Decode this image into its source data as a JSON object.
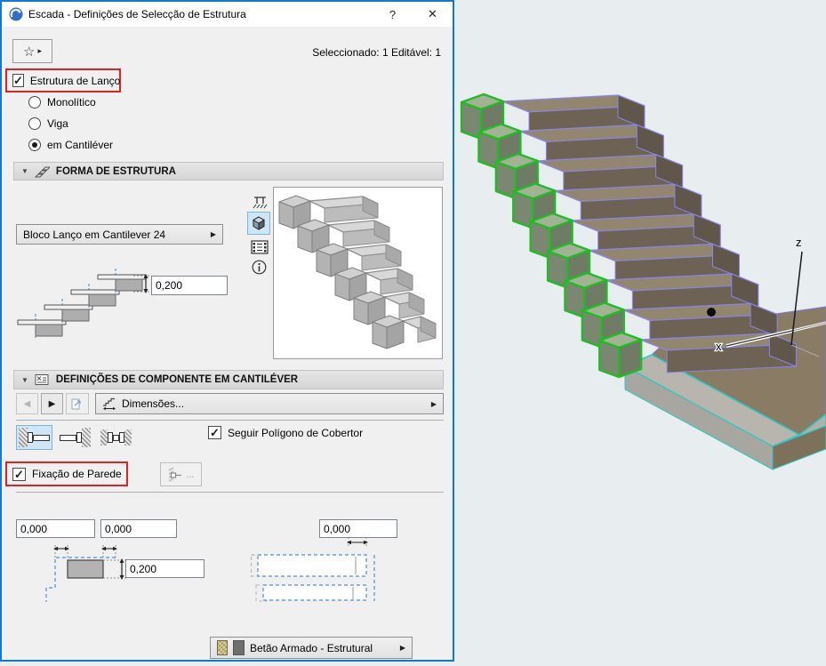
{
  "window": {
    "title": "Escada - Definições de Selecção de Estrutura",
    "help_button": "?",
    "close_button": "✕",
    "selection_status": "Seleccionado: 1 Editável: 1"
  },
  "icons": {
    "star": "☆",
    "flyout": "▸",
    "check": "✓",
    "collapse": "▼",
    "combo_arrow": "▶",
    "nav_left": "◀",
    "nav_right": "▶",
    "ellipsis": "..."
  },
  "flight_structure": {
    "checkbox_label": "Estrutura de Lanço",
    "radios": [
      {
        "label": "Monolítico",
        "selected": false
      },
      {
        "label": "Viga",
        "selected": false
      },
      {
        "label": "em Cantiléver",
        "selected": true
      }
    ]
  },
  "form_section": {
    "header": "FORMA DE ESTRUTURA",
    "profile_combo": "Bloco Lanço em Cantilever 24",
    "thickness_value": "0,200"
  },
  "component_section": {
    "header": "DEFINIÇÕES DE COMPONENTE EM CANTILÉVER",
    "dimensions_combo": "Dimensões...",
    "follow_polygon_label": "Seguir Polígono de Cobertor",
    "wall_fixing_label": "Fixação de Parede",
    "offset_left": "0,000",
    "offset_mid": "0,000",
    "offset_right": "0,000",
    "block_height": "0,200"
  },
  "material_combo": {
    "label": "Betão Armado - Estrutural"
  },
  "viewport": {
    "axis_z": "z",
    "axis_x": "x"
  },
  "colors": {
    "window_border": "#1079d8",
    "annotation_red": "#e0231c",
    "selection_green": "#1dbe23",
    "stair_outline_violet": "#8a85e8",
    "landing_outline_cyan": "#2cc8c4",
    "background": "#e8edf0"
  }
}
